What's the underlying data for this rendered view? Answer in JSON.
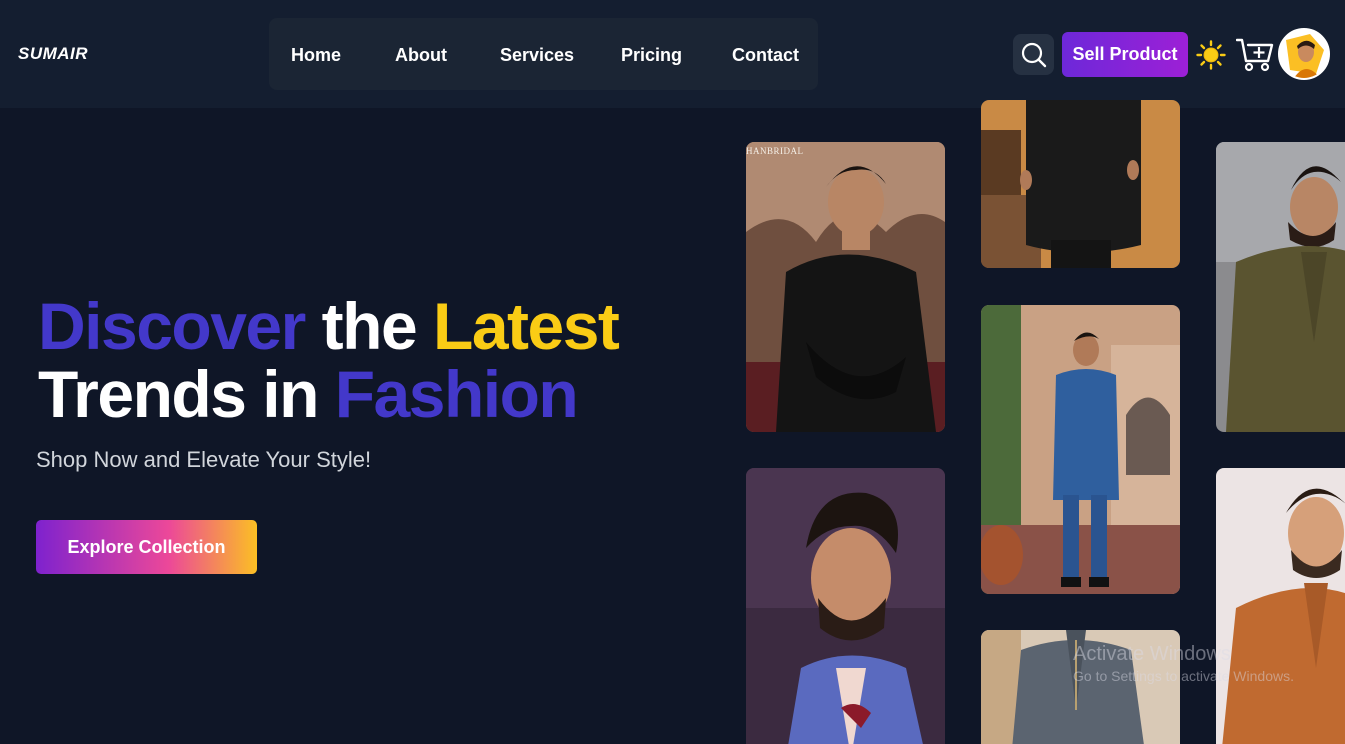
{
  "header": {
    "logo": "SUMAIR",
    "nav": [
      {
        "label": "Home"
      },
      {
        "label": "About"
      },
      {
        "label": "Services"
      },
      {
        "label": "Pricing"
      },
      {
        "label": "Contact"
      }
    ],
    "search_icon": "search-icon",
    "sell_label": "Sell Product",
    "theme_icon": "sun-icon",
    "cart_icon": "cart-plus-icon"
  },
  "hero": {
    "title_word1": "Discover",
    "title_word2": "the",
    "title_word3": "Latest",
    "title_word4": "Trends in",
    "title_word5": "Fashion",
    "subtitle": "Shop Now and Elevate Your Style!",
    "cta_label": "Explore Collection"
  },
  "gallery": {
    "brand_text": "HANBRIDAL"
  },
  "watermark": {
    "line1": "Activate Windows",
    "line2": "Go to Settings to activate Windows."
  },
  "colors": {
    "background": "#0f1627",
    "header": "#141e30",
    "accent_purple": "#4338ca",
    "accent_yellow": "#facc15",
    "sell_button": "#7e22ce"
  }
}
